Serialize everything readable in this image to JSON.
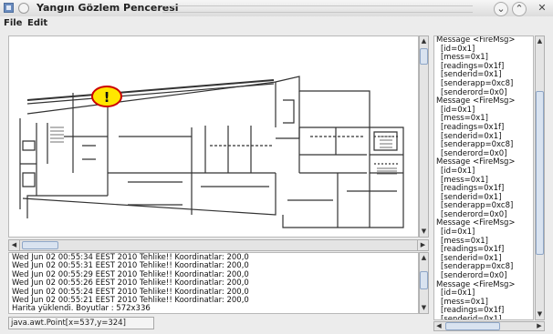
{
  "window": {
    "title": "Yangın Gözlem Penceresi",
    "controls": {
      "minimize": "⌄",
      "maximize": "⌃",
      "close": "✕"
    }
  },
  "menu": {
    "items": [
      "File",
      "Edit"
    ]
  },
  "map": {
    "alarm_marker": "!",
    "alarm_color": "#cc0000",
    "alarm_fill": "#ffe600"
  },
  "log": {
    "lines": [
      "Wed Jun 02 00:55:34 EEST 2010 Tehlike!! Koordinatlar: 200,0",
      "Wed Jun 02 00:55:31 EEST 2010 Tehlike!! Koordinatlar: 200,0",
      "Wed Jun 02 00:55:29 EEST 2010 Tehlike!! Koordinatlar: 200,0",
      "Wed Jun 02 00:55:26 EEST 2010 Tehlike!! Koordinatlar: 200,0",
      "Wed Jun 02 00:55:24 EEST 2010 Tehlike!! Koordinatlar: 200,0",
      "Wed Jun 02 00:55:21 EEST 2010 Tehlike!! Koordinatlar: 200,0",
      "Harita yüklendi. Boyutlar : 572x336"
    ]
  },
  "status": {
    "text": "java.awt.Point[x=537,y=324]"
  },
  "messages": {
    "blocks": [
      [
        "Message <FireMsg>",
        "[id=0x1]",
        "[mess=0x1]",
        "[readings=0x1f]",
        "[senderid=0x1]",
        "[senderapp=0xc8]",
        "[senderord=0x0]"
      ],
      [
        "Message <FireMsg>",
        "[id=0x1]",
        "[mess=0x1]",
        "[readings=0x1f]",
        "[senderid=0x1]",
        "[senderapp=0xc8]",
        "[senderord=0x0]"
      ],
      [
        "Message <FireMsg>",
        "[id=0x1]",
        "[mess=0x1]",
        "[readings=0x1f]",
        "[senderid=0x1]",
        "[senderapp=0xc8]",
        "[senderord=0x0]"
      ],
      [
        "Message <FireMsg>",
        "[id=0x1]",
        "[mess=0x1]",
        "[readings=0x1f]",
        "[senderid=0x1]",
        "[senderapp=0xc8]",
        "[senderord=0x0]"
      ],
      [
        "Message <FireMsg>",
        "[id=0x1]",
        "[mess=0x1]",
        "[readings=0x1f]",
        "[senderid=0x1]",
        "[senderapp=0xc8]",
        "[senderord=0x0]"
      ]
    ]
  },
  "scroll_arrows": {
    "up": "▲",
    "down": "▼",
    "left": "◀",
    "right": "▶"
  }
}
